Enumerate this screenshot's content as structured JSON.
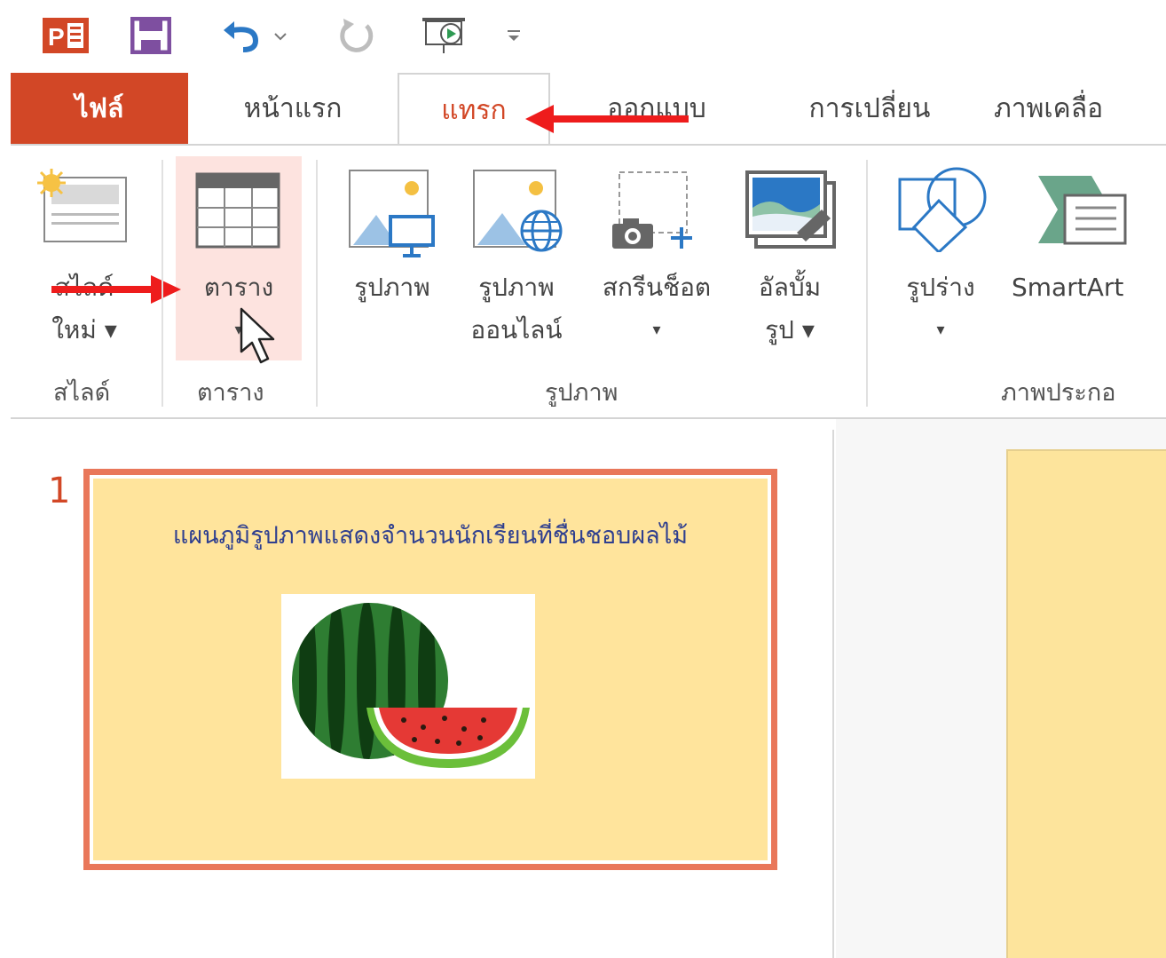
{
  "qat": {
    "app_icon": "powerpoint-icon",
    "save_icon": "save-icon",
    "undo_icon": "undo-icon",
    "redo_icon": "redo-icon",
    "present_icon": "start-slideshow-icon",
    "customize_icon": "customize-qat-icon"
  },
  "tabs": [
    {
      "label": "ไฟล์"
    },
    {
      "label": "หน้าแรก"
    },
    {
      "label": "แทรก"
    },
    {
      "label": "ออกแบบ"
    },
    {
      "label": "การเปลี่ยน"
    },
    {
      "label": "ภาพเคลื่อ"
    }
  ],
  "ribbon": {
    "new_slide": {
      "line1": "สไลด์",
      "line2": "ใหม่ ▾",
      "icon": "new-slide-icon"
    },
    "table": {
      "label": "ตาราง",
      "dropdown": "▾",
      "icon": "table-icon"
    },
    "pictures": {
      "label": "รูปภาพ",
      "icon": "picture-icon"
    },
    "online_pictures": {
      "line1": "รูปภาพ",
      "line2": "ออนไลน์",
      "icon": "online-picture-icon"
    },
    "screenshot": {
      "label": "สกรีนช็อต",
      "dropdown": "▾",
      "icon": "screenshot-icon"
    },
    "photo_album": {
      "line1": "อัลบั้ม",
      "line2": "รูป ▾",
      "icon": "photo-album-icon"
    },
    "shapes": {
      "label": "รูปร่าง",
      "dropdown": "▾",
      "icon": "shapes-icon"
    },
    "smartart": {
      "label": "SmartArt",
      "icon": "smartart-icon"
    },
    "groups": {
      "slides": "สไลด์",
      "tables": "ตาราง",
      "images": "รูปภาพ",
      "illustrations": "ภาพประกอ"
    }
  },
  "slides_pane": {
    "slide_number": "1",
    "slide_title": "แผนภูมิรูปภาพแสดงจำนวนนักเรียนที่ชื่นชอบผลไม้",
    "image_icon": "watermelon-picture"
  },
  "colors": {
    "accent": "#d24726",
    "slide_bg": "#ffe49c",
    "annotation_arrow": "#ee1c1c",
    "table_hover": "#fde3df"
  }
}
